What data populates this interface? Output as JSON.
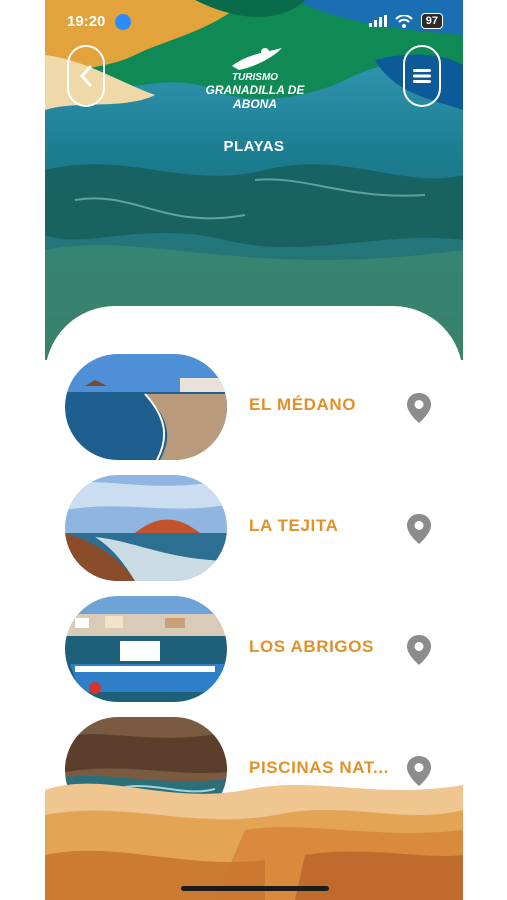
{
  "status_bar": {
    "time": "19:20",
    "battery": "97"
  },
  "brand": {
    "line1": "TURISMO",
    "line2": "GRANADILLA DE ABONA"
  },
  "page": {
    "title": "PLAYAS"
  },
  "beaches": [
    {
      "name": "EL MÉDANO"
    },
    {
      "name": "LA TEJITA"
    },
    {
      "name": "LOS ABRIGOS"
    },
    {
      "name": "PISCINAS NAT..."
    }
  ],
  "colors": {
    "accent": "#e0912a",
    "pin": "#8c8c8c",
    "sea": "#1e7d92",
    "brand_green": "#0f8a55"
  },
  "icons": {
    "back": "chevron-left-icon",
    "menu": "hamburger-menu-icon",
    "location": "map-pin-icon"
  }
}
